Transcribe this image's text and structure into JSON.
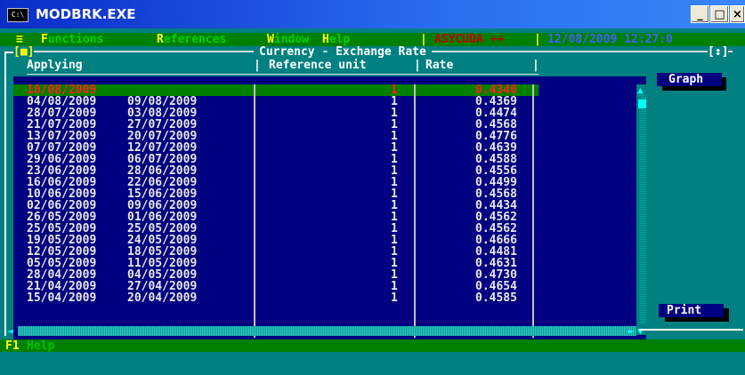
{
  "window": {
    "title": "MODBRK.EXE",
    "icon_text": "C:\\",
    "min": "_",
    "max": "□",
    "close": "×"
  },
  "menu": {
    "system": "≡",
    "items": [
      {
        "hot": "F",
        "rest": "unctions"
      },
      {
        "hot": "R",
        "rest": "eferences"
      },
      {
        "hot": "W",
        "rest": "indow"
      },
      {
        "hot": "H",
        "rest": "elp"
      }
    ],
    "status_app": "ASYCUDA ++",
    "status_datetime": "12/08/2009 12:27:0"
  },
  "screen": {
    "frame_left": "[■]",
    "frame_right": "[↕]",
    "title": "Currency - Exchange Rate",
    "columns": [
      "Applying",
      "Reference unit",
      "Rate"
    ]
  },
  "rows": [
    {
      "from": "10/08/2009",
      "to": "",
      "unit": "1",
      "rate": "0.4340"
    },
    {
      "from": "04/08/2009",
      "to": "09/08/2009",
      "unit": "1",
      "rate": "0.4369"
    },
    {
      "from": "28/07/2009",
      "to": "03/08/2009",
      "unit": "1",
      "rate": "0.4474"
    },
    {
      "from": "21/07/2009",
      "to": "27/07/2009",
      "unit": "1",
      "rate": "0.4568"
    },
    {
      "from": "13/07/2009",
      "to": "20/07/2009",
      "unit": "1",
      "rate": "0.4776"
    },
    {
      "from": "07/07/2009",
      "to": "12/07/2009",
      "unit": "1",
      "rate": "0.4639"
    },
    {
      "from": "29/06/2009",
      "to": "06/07/2009",
      "unit": "1",
      "rate": "0.4588"
    },
    {
      "from": "23/06/2009",
      "to": "28/06/2009",
      "unit": "1",
      "rate": "0.4556"
    },
    {
      "from": "16/06/2009",
      "to": "22/06/2009",
      "unit": "1",
      "rate": "0.4499"
    },
    {
      "from": "10/06/2009",
      "to": "15/06/2009",
      "unit": "1",
      "rate": "0.4568"
    },
    {
      "from": "02/06/2009",
      "to": "09/06/2009",
      "unit": "1",
      "rate": "0.4434"
    },
    {
      "from": "26/05/2009",
      "to": "01/06/2009",
      "unit": "1",
      "rate": "0.4562"
    },
    {
      "from": "25/05/2009",
      "to": "25/05/2009",
      "unit": "1",
      "rate": "0.4562"
    },
    {
      "from": "19/05/2009",
      "to": "24/05/2009",
      "unit": "1",
      "rate": "0.4666"
    },
    {
      "from": "12/05/2009",
      "to": "18/05/2009",
      "unit": "1",
      "rate": "0.4481"
    },
    {
      "from": "05/05/2009",
      "to": "11/05/2009",
      "unit": "1",
      "rate": "0.4631"
    },
    {
      "from": "28/04/2009",
      "to": "04/05/2009",
      "unit": "1",
      "rate": "0.4730"
    },
    {
      "from": "21/04/2009",
      "to": "27/04/2009",
      "unit": "1",
      "rate": "0.4654"
    },
    {
      "from": "15/04/2009",
      "to": "20/04/2009",
      "unit": "1",
      "rate": "0.4585"
    }
  ],
  "buttons": {
    "graph": "Graph",
    "print": "Print"
  },
  "footer": {
    "key": "F1",
    "label": "Help"
  },
  "colors": {
    "background": "#000080",
    "selected_row": "#008000",
    "selected_text": "#ff2020",
    "menubar": "#008000"
  }
}
